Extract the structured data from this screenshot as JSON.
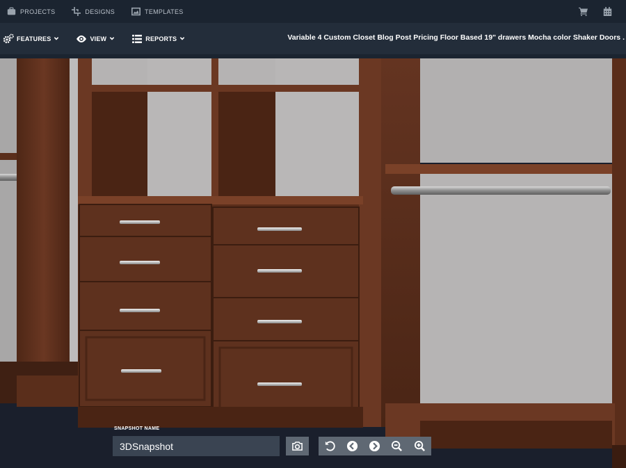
{
  "topnav": {
    "items": [
      {
        "label": "PROJECTS",
        "icon": "briefcase-icon"
      },
      {
        "label": "DESIGNS",
        "icon": "crop-icon"
      },
      {
        "label": "TEMPLATES",
        "icon": "image-icon"
      }
    ],
    "right_icons": [
      "cart-icon",
      "calendar-icon"
    ]
  },
  "toolbar": {
    "menus": [
      {
        "label": "FEATURES",
        "icon": "gears-icon"
      },
      {
        "label": "VIEW",
        "icon": "eye-icon"
      },
      {
        "label": "REPORTS",
        "icon": "list-icon"
      }
    ],
    "design_title": "Variable 4 Custom Closet Blog Post Pricing Floor Based 19\" drawers Mocha color Shaker Doors ."
  },
  "snapshot": {
    "label": "SNAPSHOT NAME",
    "value": "3DSnapshot"
  },
  "controls": [
    "camera-icon",
    "reset-icon",
    "rotate-left-icon",
    "rotate-right-icon",
    "zoom-out-icon",
    "zoom-in-icon"
  ],
  "colors": {
    "nav_bg": "#1b2430",
    "toolbar_bg": "#232d3a",
    "wood": "#5b2f1c",
    "wall": "#b3b1b1",
    "button_bg": "#5f6873"
  }
}
